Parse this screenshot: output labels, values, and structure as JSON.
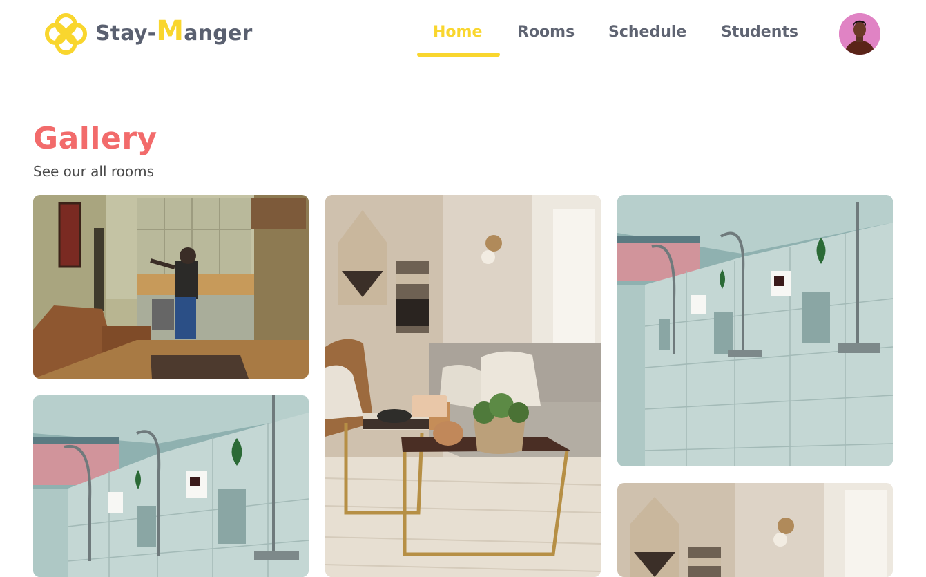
{
  "brand": {
    "prefix": "Stay-",
    "highlight": "M",
    "suffix": "anger"
  },
  "nav": {
    "items": [
      {
        "label": "Home",
        "active": true
      },
      {
        "label": "Rooms",
        "active": false
      },
      {
        "label": "Schedule",
        "active": false
      },
      {
        "label": "Students",
        "active": false
      }
    ]
  },
  "gallery": {
    "title": "Gallery",
    "subtitle": "See our all rooms",
    "photos": [
      {
        "subject": "kitchen-living-room"
      },
      {
        "subject": "lounge-with-coffee-table"
      },
      {
        "subject": "shower-room"
      },
      {
        "subject": "shower-room"
      },
      {
        "subject": "lounge-with-wall-hangings"
      }
    ]
  },
  "colors": {
    "accent": "#f9d62e",
    "title": "#f26b6b",
    "nav_text": "#5f6472"
  }
}
